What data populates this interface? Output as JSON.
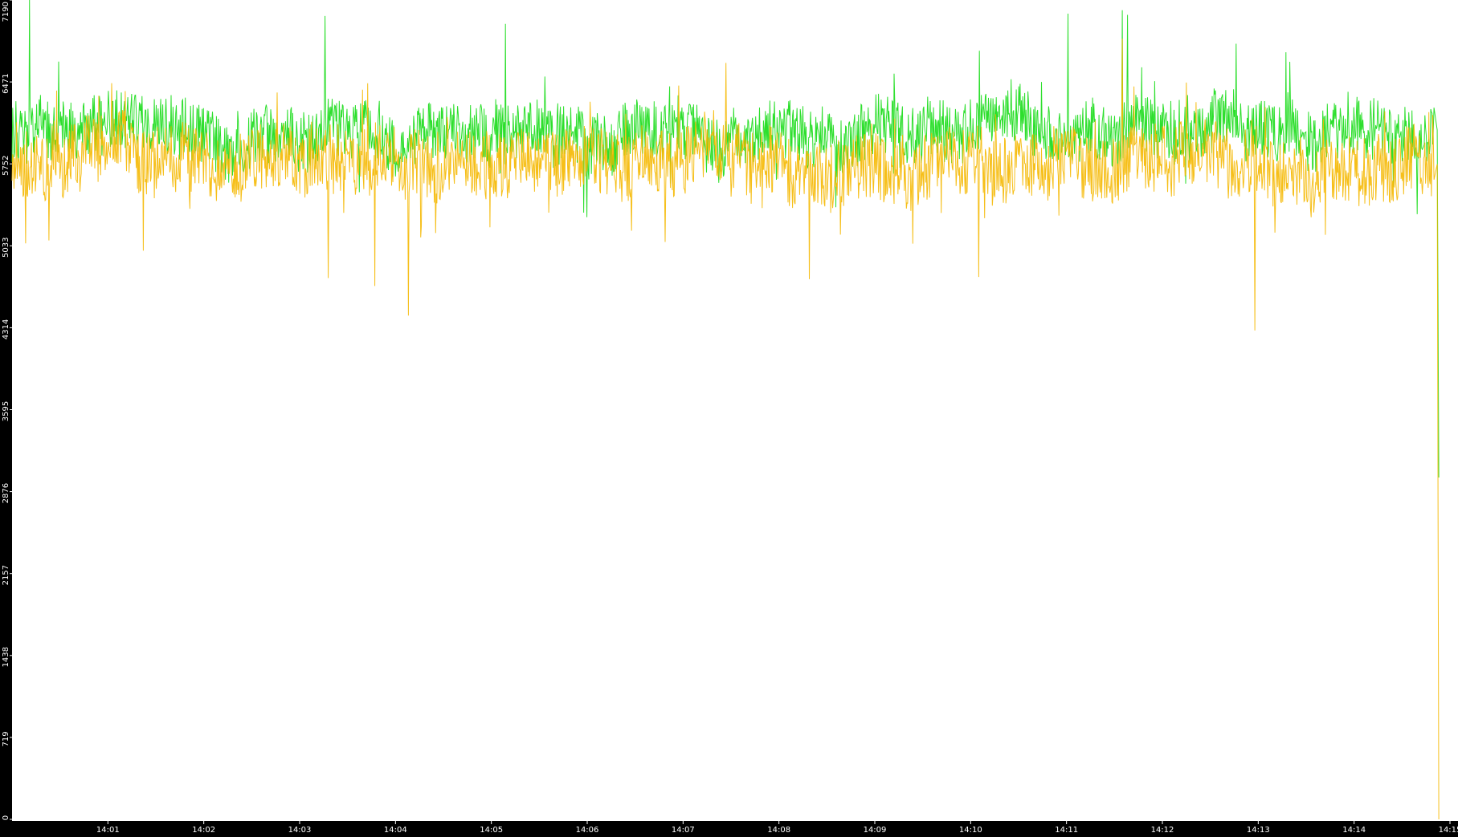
{
  "chart_data": {
    "type": "line",
    "title": "",
    "xlabel": "",
    "ylabel": "",
    "ylim": [
      0,
      7190
    ],
    "y_ticks": [
      "0",
      "719",
      "1438",
      "2157",
      "2876",
      "3595",
      "4314",
      "5033",
      "5752",
      "6471",
      "7190"
    ],
    "x_ticks": [
      "14:01",
      "14:02",
      "14:03",
      "14:04",
      "14:05",
      "14:06",
      "14:07",
      "14:08",
      "14:09",
      "14:10",
      "14:11",
      "14:12",
      "14:13",
      "14:14",
      "14:15"
    ],
    "x_range_minutes": [
      "14:00",
      "14:15"
    ],
    "grid": false,
    "legend": "none",
    "colors": {
      "background": "#000000",
      "plot_background": "#ffffff",
      "axis_text": "#ffffff"
    },
    "series": [
      {
        "color": "#22dd22",
        "mean": 6050,
        "noise": 260,
        "spikes": [
          {
            "t": "14:00:11",
            "value": 7190
          },
          {
            "t": "14:00:29",
            "value": 6650
          },
          {
            "t": "14:03:16",
            "value": 7050
          },
          {
            "t": "14:05:09",
            "value": 6980
          },
          {
            "t": "14:11:01",
            "value": 7070
          },
          {
            "t": "14:11:35",
            "value": 7100
          },
          {
            "t": "14:11:38",
            "value": 7060
          }
        ],
        "end_value": 3000
      },
      {
        "color": "#f5b800",
        "mean": 5750,
        "noise": 300,
        "dips": [
          {
            "t": "14:00:23",
            "value": 5080
          },
          {
            "t": "14:01:22",
            "value": 4990
          },
          {
            "t": "14:03:18",
            "value": 4750
          },
          {
            "t": "14:03:47",
            "value": 4680
          },
          {
            "t": "14:04:08",
            "value": 4420
          },
          {
            "t": "14:08:19",
            "value": 4740
          },
          {
            "t": "14:10:05",
            "value": 4760
          },
          {
            "t": "14:12:58",
            "value": 4290
          }
        ],
        "spikes": [
          {
            "t": "14:11:35",
            "value": 6850
          }
        ],
        "end_value": 0
      }
    ]
  }
}
